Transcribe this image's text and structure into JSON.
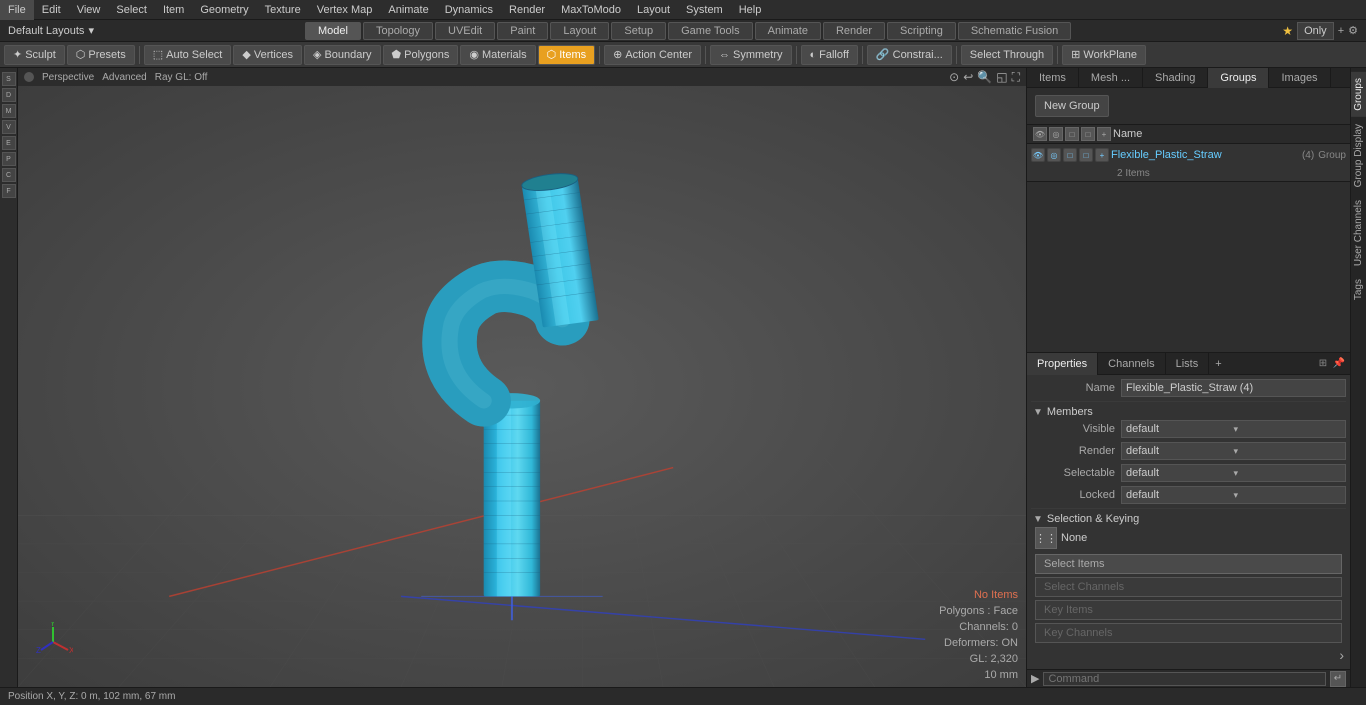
{
  "menus": {
    "items": [
      "File",
      "Edit",
      "View",
      "Select",
      "Item",
      "Geometry",
      "Texture",
      "Vertex Map",
      "Animate",
      "Dynamics",
      "Render",
      "MaxToModo",
      "Layout",
      "System",
      "Help"
    ]
  },
  "layout_bar": {
    "left_label": "Default Layouts",
    "tabs": [
      "Model",
      "Topology",
      "UVEdit",
      "Paint",
      "Layout",
      "Setup",
      "Game Tools",
      "Animate",
      "Render",
      "Scripting",
      "Schematic Fusion"
    ],
    "active_tab": "Model",
    "right_star": "★",
    "right_only": "Only",
    "right_plus": "+"
  },
  "toolbar": {
    "sculpt": "Sculpt",
    "presets": "Presets",
    "auto_select": "Auto Select",
    "vertices": "Vertices",
    "boundary": "Boundary",
    "polygons": "Polygons",
    "materials": "Materials",
    "items": "Items",
    "action_center": "Action Center",
    "symmetry": "Symmetry",
    "falloff": "Falloff",
    "constraints": "Constrai...",
    "select_through": "Select Through",
    "work_plane": "WorkPlane"
  },
  "viewport": {
    "dot": "●",
    "mode": "Perspective",
    "shading": "Advanced",
    "gl": "Ray GL: Off",
    "info": {
      "no_items": "No Items",
      "polygons": "Polygons : Face",
      "channels": "Channels: 0",
      "deformers": "Deformers: ON",
      "gl": "GL: 2,320",
      "unit": "10 mm"
    },
    "status": "Position X, Y, Z:  0 m, 102 mm, 67 mm"
  },
  "scene_panel": {
    "tabs": [
      "Items",
      "Mesh ...",
      "Shading",
      "Groups",
      "Images"
    ],
    "active_tab": "Groups",
    "new_group_btn": "New Group",
    "list_header": {
      "name_col": "Name"
    },
    "item": {
      "name": "Flexible_Plastic_Straw",
      "suffix": "(4)",
      "type": "Group",
      "sub_info": "2 Items"
    }
  },
  "props_panel": {
    "tabs": [
      "Properties",
      "Channels",
      "Lists"
    ],
    "active_tab": "Properties",
    "add_tab": "+",
    "name_label": "Name",
    "name_value": "Flexible_Plastic_Straw (4)",
    "members_section": "Members",
    "fields": [
      {
        "label": "Visible",
        "value": "default"
      },
      {
        "label": "Render",
        "value": "default"
      },
      {
        "label": "Selectable",
        "value": "default"
      },
      {
        "label": "Locked",
        "value": "default"
      }
    ],
    "sel_keying_section": "Selection & Keying",
    "sel_none_icon": "⋮⋮",
    "sel_none_label": "None",
    "buttons": [
      {
        "label": "Select Items",
        "disabled": false
      },
      {
        "label": "Select Channels",
        "disabled": true
      },
      {
        "label": "Key Items",
        "disabled": true
      },
      {
        "label": "Key Channels",
        "disabled": true
      }
    ]
  },
  "right_vtabs": [
    "Groups",
    "Group Display",
    "User Channels",
    "Tags"
  ],
  "command_bar": {
    "arrow": "▶",
    "placeholder": "Command",
    "enter_icon": "↵"
  }
}
